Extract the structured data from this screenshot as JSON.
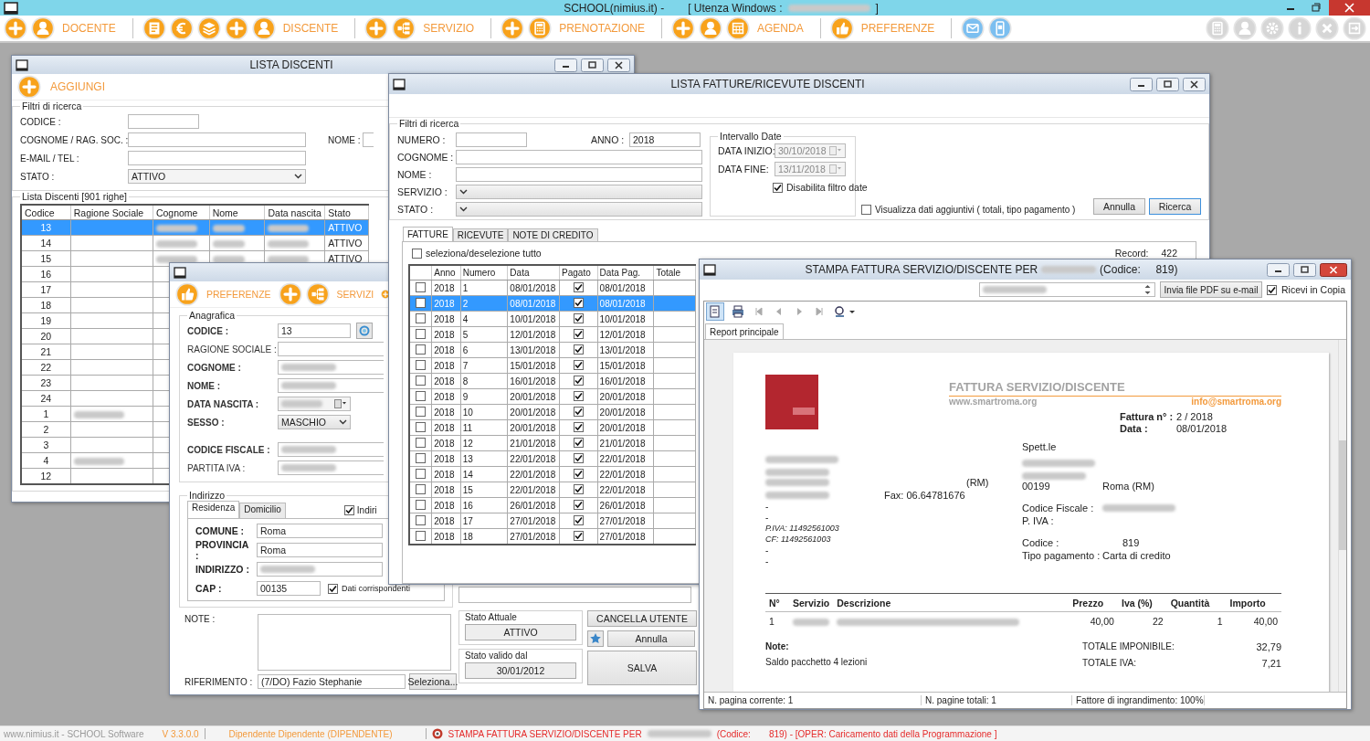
{
  "app": {
    "title": "SCHOOL(nimius.it) -",
    "user_label": "[ Utenza Windows :",
    "user_blurred": true,
    "user_end": "]"
  },
  "toolbar": [
    {
      "kind": "add"
    },
    {
      "kind": "person"
    },
    {
      "kind": "label",
      "text": "DOCENTE"
    },
    {
      "kind": "separator"
    },
    {
      "kind": "document"
    },
    {
      "kind": "euro"
    },
    {
      "kind": "layers"
    },
    {
      "kind": "add"
    },
    {
      "kind": "person"
    },
    {
      "kind": "label",
      "text": "DISCENTE"
    },
    {
      "kind": "separator"
    },
    {
      "kind": "add"
    },
    {
      "kind": "tree"
    },
    {
      "kind": "label",
      "text": "SERVIZIO"
    },
    {
      "kind": "separator"
    },
    {
      "kind": "add"
    },
    {
      "kind": "calculator"
    },
    {
      "kind": "label",
      "text": "PRENOTAZIONE"
    },
    {
      "kind": "separator"
    },
    {
      "kind": "add"
    },
    {
      "kind": "person"
    },
    {
      "kind": "calendar"
    },
    {
      "kind": "label",
      "text": "AGENDA"
    },
    {
      "kind": "separator"
    },
    {
      "kind": "thumb"
    },
    {
      "kind": "label",
      "text": "PREFERENZE"
    },
    {
      "kind": "separator"
    },
    {
      "kind": "mail"
    },
    {
      "kind": "phone"
    }
  ],
  "toolbar_right": [
    {
      "kind": "calculator",
      "disabled": true
    },
    {
      "kind": "person",
      "disabled": true
    },
    {
      "kind": "gear",
      "disabled": true
    },
    {
      "kind": "info",
      "disabled": true
    },
    {
      "kind": "close",
      "disabled": true
    },
    {
      "kind": "exit",
      "disabled": true
    }
  ],
  "lista_discenti": {
    "title": "LISTA DISCENTI",
    "add_button": "AGGIUNGI",
    "filters_title": "Filtri di ricerca",
    "filters": [
      {
        "label": "CODICE :",
        "kind": "short"
      },
      {
        "label": "COGNOME / RAG. SOC. :",
        "kind": "text"
      },
      {
        "label": "E-MAIL / TEL :",
        "kind": "text"
      },
      {
        "label": "STATO :",
        "kind": "select",
        "value": "ATTIVO"
      }
    ],
    "nome_label": "NOME :",
    "list_title": "Lista Discenti [901 righe]",
    "columns": [
      "Codice",
      "Ragione Sociale",
      "Cognome",
      "Nome",
      "Data nascita",
      "Stato"
    ],
    "rows": [
      {
        "codice": "13",
        "stato": "ATTIVO",
        "details_blurred": true,
        "company_blurred": false,
        "selected": true
      },
      {
        "codice": "14",
        "stato": "ATTIVO",
        "details_blurred": true,
        "company_blurred": false,
        "selected": false
      },
      {
        "codice": "15",
        "stato": "ATTIVO",
        "details_blurred": true,
        "company_blurred": false,
        "selected": false
      },
      {
        "codice": "16",
        "details_blurred": false,
        "company_blurred": false,
        "selected": false
      },
      {
        "codice": "17",
        "details_blurred": false,
        "company_blurred": false,
        "selected": false
      },
      {
        "codice": "18",
        "details_blurred": false,
        "company_blurred": false,
        "selected": false
      },
      {
        "codice": "19",
        "details_blurred": false,
        "company_blurred": false,
        "selected": false
      },
      {
        "codice": "20",
        "details_blurred": false,
        "company_blurred": false,
        "selected": false
      },
      {
        "codice": "21",
        "details_blurred": false,
        "company_blurred": false,
        "selected": false
      },
      {
        "codice": "22",
        "details_blurred": false,
        "company_blurred": false,
        "selected": false
      },
      {
        "codice": "23",
        "details_blurred": false,
        "company_blurred": false,
        "selected": false
      },
      {
        "codice": "24",
        "details_blurred": false,
        "company_blurred": false,
        "selected": false
      },
      {
        "codice": "1",
        "details_blurred": false,
        "company_blurred": true,
        "selected": false
      },
      {
        "codice": "2",
        "details_blurred": false,
        "company_blurred": false,
        "selected": false
      },
      {
        "codice": "3",
        "details_blurred": false,
        "company_blurred": false,
        "selected": false
      },
      {
        "codice": "4",
        "details_blurred": false,
        "company_blurred": true,
        "selected": false
      },
      {
        "codice": "12",
        "details_blurred": false,
        "company_blurred": false,
        "selected": false
      }
    ]
  },
  "scheda_discente": {
    "toolbar": [
      {
        "kind": "thumb"
      },
      {
        "kind": "label",
        "text": "PREFERENZE"
      },
      {
        "kind": "add"
      },
      {
        "kind": "tree"
      },
      {
        "kind": "label",
        "text": "SERVIZI"
      },
      {
        "kind": "add"
      }
    ],
    "anagrafica_title": "Anagrafica",
    "fields": [
      {
        "label": "CODICE :",
        "kind": "code",
        "value": "13",
        "required": true
      },
      {
        "label": "RAGIONE SOCIALE :",
        "kind": "text",
        "required": false
      },
      {
        "label": "COGNOME :",
        "kind": "text",
        "required": true,
        "blurred": true
      },
      {
        "label": "NOME :",
        "kind": "text",
        "required": true,
        "blurred": true
      },
      {
        "label": "DATA NASCITA :",
        "kind": "date",
        "required": true,
        "blurred": true
      },
      {
        "label": "SESSO :",
        "kind": "select",
        "value": "MASCHIO",
        "required": true
      },
      {
        "label": "CODICE FISCALE :",
        "kind": "text",
        "required": true,
        "blurred": true
      },
      {
        "label": "PARTITA IVA :",
        "kind": "text",
        "required": false,
        "blurred": true
      }
    ],
    "indirizzo_title": "Indirizzo",
    "address_tabs": [
      {
        "label": "Residenza",
        "selected": true
      },
      {
        "label": "Domicilio",
        "selected": false
      }
    ],
    "address_check": {
      "label": "Indiri",
      "checked": true
    },
    "address_fields": [
      {
        "label": "COMUNE :",
        "value": "Roma"
      },
      {
        "label": "PROVINCIA :",
        "value": "Roma"
      },
      {
        "label": "INDIRIZZO :",
        "blurred": true
      },
      {
        "label": "CAP :",
        "value": "00135",
        "kind": "cap"
      }
    ],
    "same_check": {
      "label": "Dati corrispondenti",
      "checked": true
    },
    "note_label": "NOTE :",
    "riferimento_label": "RIFERIMENTO :",
    "riferimento_value": "(7/DO) Fazio Stephanie",
    "seleziona": "Seleziona...",
    "stato_attuale_title": "Stato Attuale",
    "stato_attuale": "ATTIVO",
    "stato_valido_title": "Stato valido dal",
    "stato_valido": "30/01/2012",
    "cancella": "CANCELLA UTENTE",
    "annulla": "Annulla",
    "salva": "SALVA"
  },
  "fatture": {
    "title": "LISTA FATTURE/RICEVUTE DISCENTI",
    "filters_title": "Filtri di ricerca",
    "numero_label": "NUMERO :",
    "anno_label": "ANNO :",
    "anno": "2018",
    "cognome_label": "COGNOME :",
    "nome_label": "NOME :",
    "servizio_label": "SERVIZIO :",
    "stato_label": "STATO :",
    "date_title": "Intervallo Date",
    "date_fields": [
      {
        "label": "DATA INIZIO:",
        "value": "30/10/2018",
        "disabled": true
      },
      {
        "label": "DATA FINE:",
        "value": "13/11/2018",
        "disabled": true
      }
    ],
    "date_check": {
      "label": "Disabilita filtro date",
      "checked": true
    },
    "extra_check": {
      "label": "Visualizza dati aggiuntivi ( totali, tipo pagamento )",
      "checked": false
    },
    "annulla": "Annulla",
    "ricerca": "Ricerca",
    "tabs": [
      {
        "label": "FATTURE",
        "selected": true
      },
      {
        "label": "RICEVUTE",
        "selected": false
      },
      {
        "label": "NOTE DI CREDITO",
        "selected": false
      }
    ],
    "select_all": {
      "label": "seleziona/deselezione tutto",
      "checked": false
    },
    "record_label": "Record:",
    "record_count": "422",
    "columns": [
      "Anno",
      "Numero",
      "Data",
      "Pagato",
      "Data Pag.",
      "Totale"
    ],
    "rows": [
      {
        "checked": false,
        "anno": "2018",
        "numero": "1",
        "data": "08/01/2018",
        "pagato": true,
        "data_pag": "08/01/2018",
        "selected": false
      },
      {
        "checked": false,
        "anno": "2018",
        "numero": "2",
        "data": "08/01/2018",
        "pagato": true,
        "data_pag": "08/01/2018",
        "selected": true
      },
      {
        "checked": false,
        "anno": "2018",
        "numero": "4",
        "data": "10/01/2018",
        "pagato": true,
        "data_pag": "10/01/2018",
        "selected": false
      },
      {
        "checked": false,
        "anno": "2018",
        "numero": "5",
        "data": "12/01/2018",
        "pagato": true,
        "data_pag": "12/01/2018",
        "selected": false
      },
      {
        "checked": false,
        "anno": "2018",
        "numero": "6",
        "data": "13/01/2018",
        "pagato": true,
        "data_pag": "13/01/2018",
        "selected": false
      },
      {
        "checked": false,
        "anno": "2018",
        "numero": "7",
        "data": "15/01/2018",
        "pagato": true,
        "data_pag": "15/01/2018",
        "selected": false
      },
      {
        "checked": false,
        "anno": "2018",
        "numero": "8",
        "data": "16/01/2018",
        "pagato": true,
        "data_pag": "16/01/2018",
        "selected": false
      },
      {
        "checked": false,
        "anno": "2018",
        "numero": "9",
        "data": "20/01/2018",
        "pagato": true,
        "data_pag": "20/01/2018",
        "selected": false
      },
      {
        "checked": false,
        "anno": "2018",
        "numero": "10",
        "data": "20/01/2018",
        "pagato": true,
        "data_pag": "20/01/2018",
        "selected": false
      },
      {
        "checked": false,
        "anno": "2018",
        "numero": "11",
        "data": "20/01/2018",
        "pagato": true,
        "data_pag": "20/01/2018",
        "selected": false
      },
      {
        "checked": false,
        "anno": "2018",
        "numero": "12",
        "data": "21/01/2018",
        "pagato": true,
        "data_pag": "21/01/2018",
        "selected": false
      },
      {
        "checked": false,
        "anno": "2018",
        "numero": "13",
        "data": "22/01/2018",
        "pagato": true,
        "data_pag": "22/01/2018",
        "selected": false
      },
      {
        "checked": false,
        "anno": "2018",
        "numero": "14",
        "data": "22/01/2018",
        "pagato": true,
        "data_pag": "22/01/2018",
        "selected": false
      },
      {
        "checked": false,
        "anno": "2018",
        "numero": "15",
        "data": "22/01/2018",
        "pagato": true,
        "data_pag": "22/01/2018",
        "selected": false
      },
      {
        "checked": false,
        "anno": "2018",
        "numero": "16",
        "data": "26/01/2018",
        "pagato": true,
        "data_pag": "26/01/2018",
        "selected": false
      },
      {
        "checked": false,
        "anno": "2018",
        "numero": "17",
        "data": "27/01/2018",
        "pagato": true,
        "data_pag": "27/01/2018",
        "selected": false
      },
      {
        "checked": false,
        "anno": "2018",
        "numero": "18",
        "data": "27/01/2018",
        "pagato": true,
        "data_pag": "27/01/2018",
        "selected": false
      }
    ]
  },
  "stampa": {
    "title": "STAMPA FATTURA SERVIZIO/DISCENTE PER",
    "title_code": "(Codice:     819)",
    "email_blurred": true,
    "send_button": "Invia file PDF su e-mail",
    "copy_check": {
      "label": "Ricevi in Copia",
      "checked": true
    },
    "report_tab": "Report principale",
    "report": {
      "heading": "FATTURA SERVIZIO/DISCENTE",
      "website": "www.smartroma.org",
      "email": "info@smartroma.org",
      "invoice_no_label": "Fattura n° :",
      "invoice_no": "2 / 2018",
      "date_label": "Data :",
      "date": "08/01/2018",
      "recipient_label": "Spett.le",
      "issuer_province": "(RM)",
      "issuer_fax": "Fax: 06.64781676",
      "issuer_lines": [
        {
          "text": "-",
          "italic": false
        },
        {
          "text": "-",
          "italic": false
        },
        {
          "text": "P.IVA: 11492561003",
          "italic": true
        },
        {
          "text": "CF: 11492561003",
          "italic": true
        },
        {
          "text": "-",
          "italic": false
        },
        {
          "text": "-",
          "italic": false
        }
      ],
      "customer_cap": "00199",
      "customer_city": "Roma (RM)",
      "cf_label": "Codice Fiscale :",
      "piva_label": "P. IVA :",
      "code_label": "Codice :",
      "code": "819",
      "payment_label": "Tipo pagamento :",
      "payment": "Carta di credito",
      "columns": [
        "N°",
        "Servizio",
        "Descrizione",
        "Prezzo",
        "Iva (%)",
        "Quantità",
        "Importo"
      ],
      "items": [
        {
          "n": "1",
          "prezzo": "40,00",
          "iva": "22",
          "quantita": "1",
          "importo": "40,00"
        }
      ],
      "notes_label": "Note:",
      "notes": "Saldo pacchetto 4 lezioni",
      "totals": [
        {
          "label": "TOTALE IMPONIBILE:",
          "value": "32,79"
        },
        {
          "label": "TOTALE IVA:",
          "value": "7,21"
        }
      ]
    },
    "status": [
      "N. pagina corrente: 1",
      "N. pagine totali: 1",
      "Fattore di ingrandimento: 100%"
    ]
  },
  "status_bar": {
    "site": "www.nimius.it - SCHOOL Software",
    "version": "V 3.3.0.0",
    "user": "Dipendente Dipendente (DIPENDENTE)",
    "message": "STAMPA FATTURA SERVIZIO/DISCENTE PER",
    "message_code": "(Codice:",
    "message_tail": "819) - [OPER: Caricamento dati della Programmazione ]"
  }
}
